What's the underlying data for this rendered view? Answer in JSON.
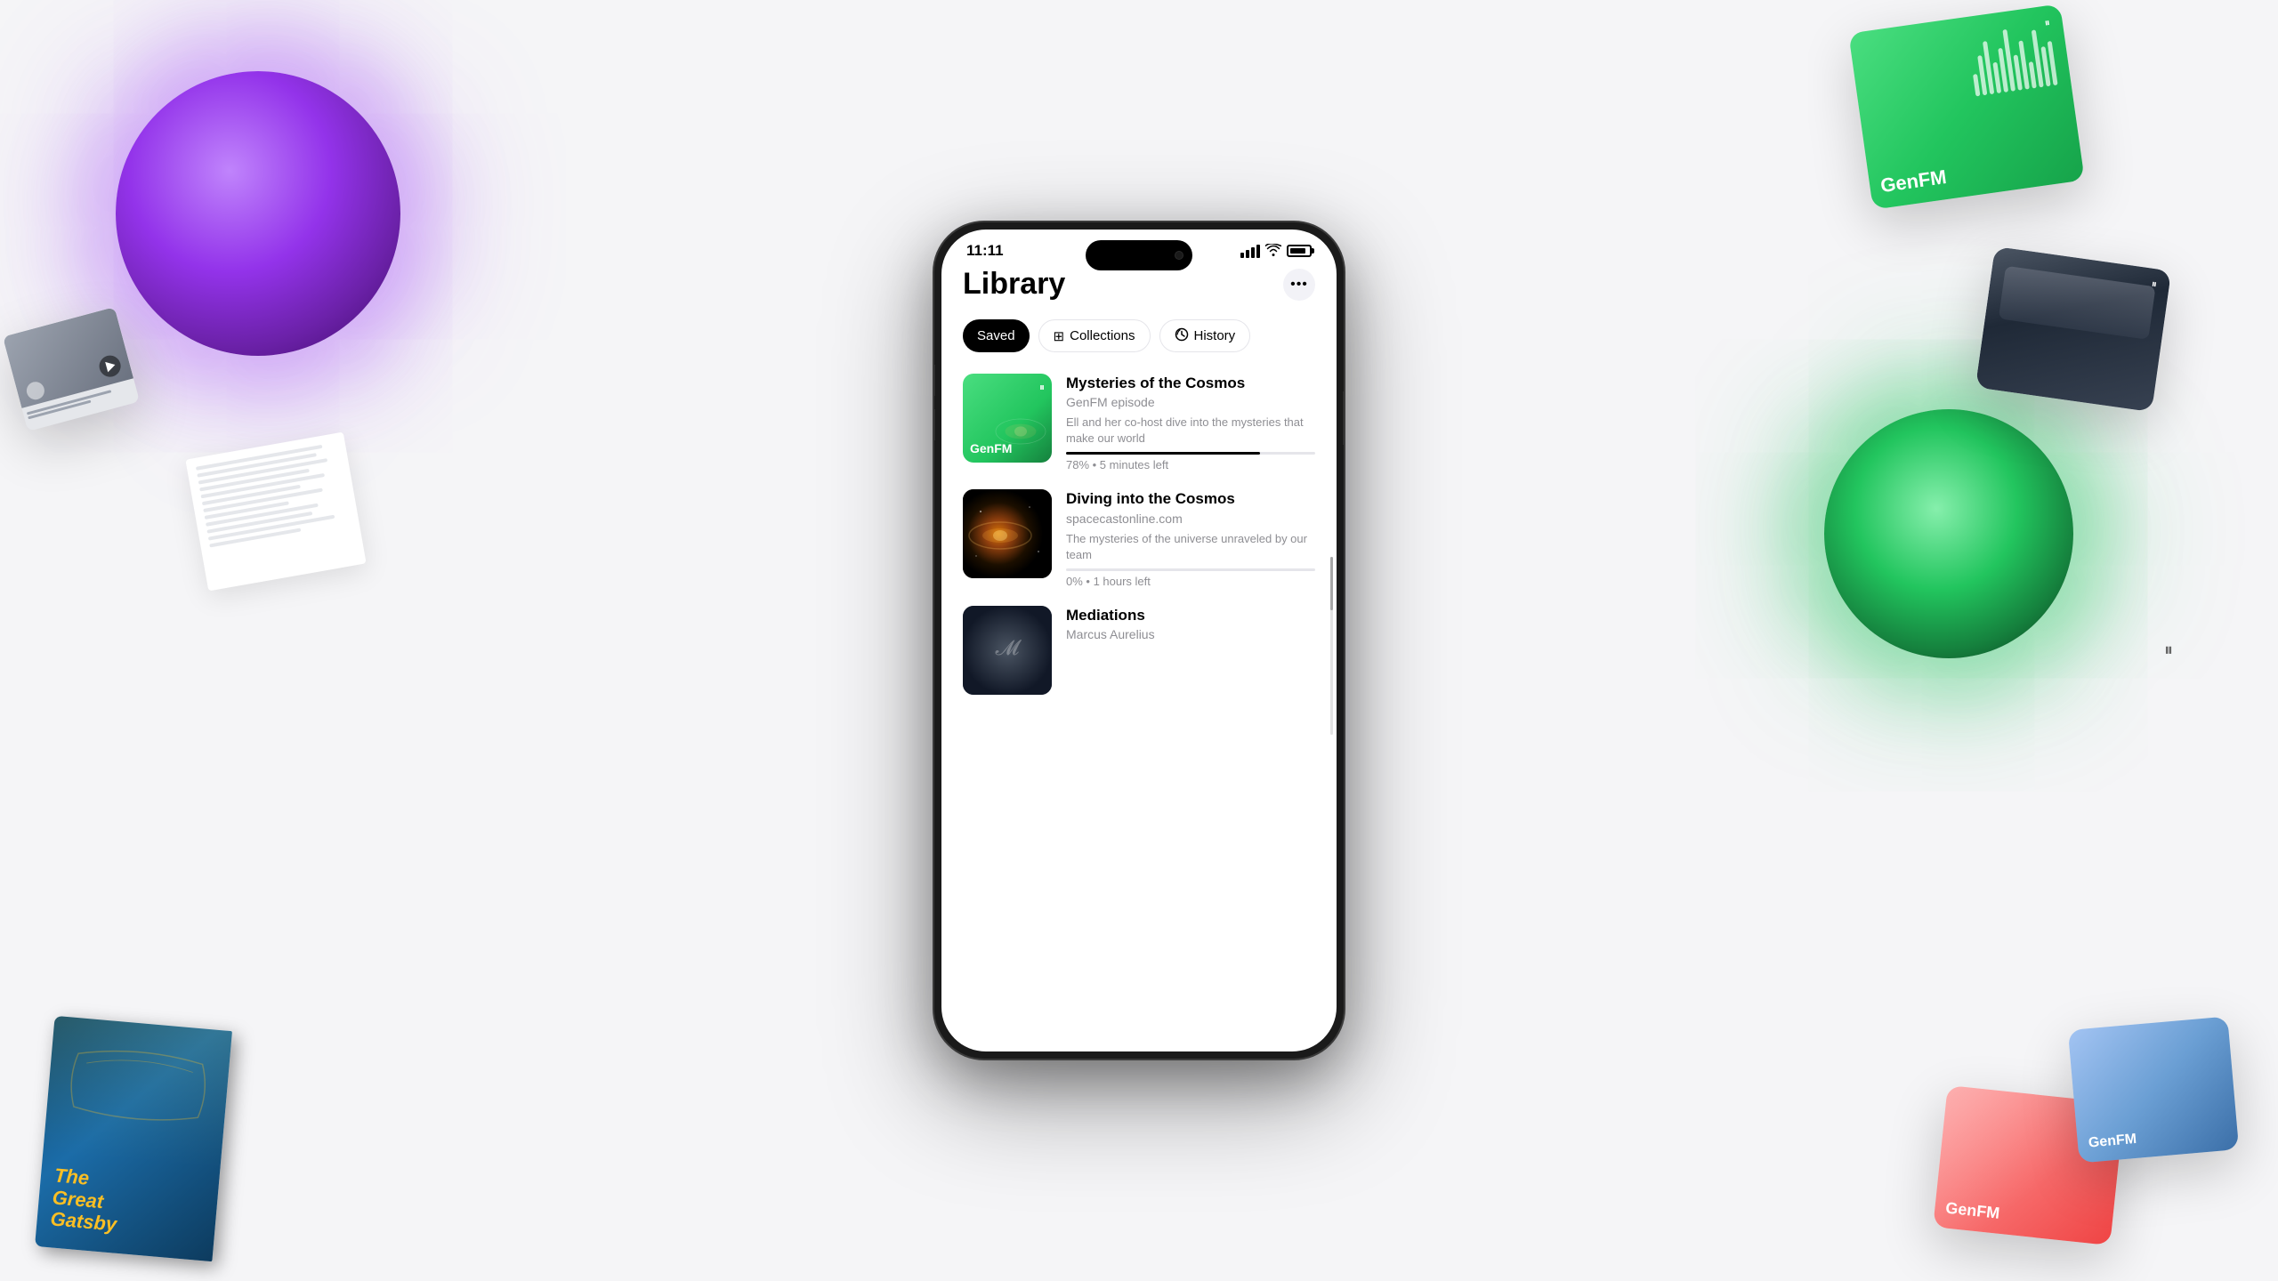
{
  "background": {
    "color": "#f5f5f7"
  },
  "floating_elements": {
    "purple_orb": {
      "label": "purple-orb"
    },
    "green_orb": {
      "label": "green-orb"
    },
    "genfm_top_card": {
      "label": "GenFM",
      "pause_icon": "⏸"
    },
    "gatsby_book": {
      "title": "The\nGreat\nGatsby"
    },
    "genfm_br_card": {
      "label": "GenFM",
      "pause_icon": "⏸"
    },
    "genfm_br2_card": {
      "label": "GenFM"
    }
  },
  "phone": {
    "status_bar": {
      "time": "11:11",
      "pause_icon": "⏸"
    },
    "screen": {
      "header": {
        "title": "Library",
        "more_button_label": "•••"
      },
      "tabs": [
        {
          "id": "saved",
          "label": "Saved",
          "icon": "",
          "active": true
        },
        {
          "id": "collections",
          "label": "Collections",
          "icon": "⊞",
          "active": false
        },
        {
          "id": "history",
          "label": "History",
          "icon": "↺",
          "active": false
        }
      ],
      "items": [
        {
          "id": "mysteries-cosmos",
          "title": "Mysteries of the Cosmos",
          "source": "GenFM episode",
          "description": "Ell and her co-host dive into the mysteries that make our world",
          "progress_percent": 78,
          "progress_label": "78% • 5 minutes left",
          "thumbnail_type": "genfm",
          "thumbnail_label": "GenFM",
          "has_pause": true
        },
        {
          "id": "diving-cosmos",
          "title": "Diving into the Cosmos",
          "source": "spacecastonline.com",
          "description": "The mysteries of the universe unraveled by our team",
          "progress_percent": 0,
          "progress_label": "0% • 1 hours left",
          "thumbnail_type": "cosmos",
          "thumbnail_label": "",
          "has_pause": false
        },
        {
          "id": "mediations",
          "title": "Mediations",
          "source": "Marcus Aurelius",
          "description": "",
          "progress_percent": 0,
          "progress_label": "",
          "thumbnail_type": "dark",
          "thumbnail_label": "",
          "has_pause": false
        }
      ]
    }
  },
  "tab_labels": {
    "collections": "Collections",
    "history": "History",
    "saved": "Saved"
  }
}
